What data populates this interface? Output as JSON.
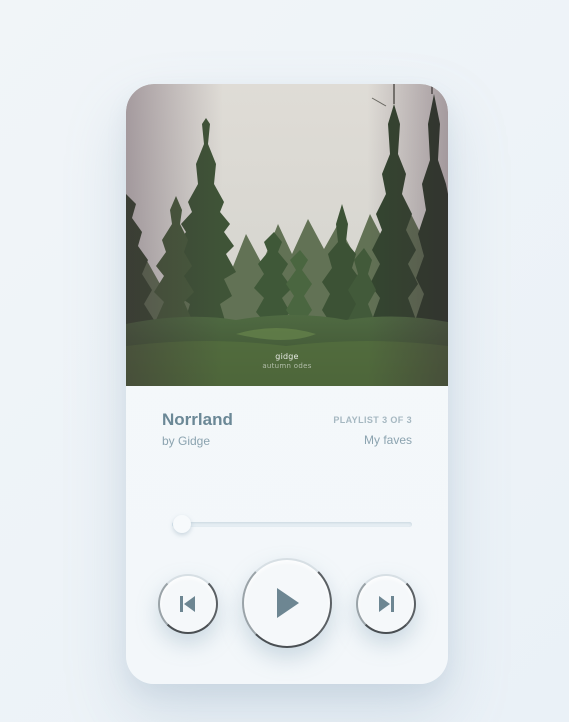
{
  "cover": {
    "artist_text": "gidge",
    "album_text": "autumn odes"
  },
  "track": {
    "title": "Norrland",
    "artist": "by Gidge"
  },
  "playlist": {
    "position_label": "PLAYLIST 3 OF 3",
    "name": "My faves"
  },
  "progress": {
    "fraction": 0.04
  },
  "controls": {
    "previous_icon": "skip-previous-icon",
    "play_icon": "play-icon",
    "next_icon": "skip-next-icon"
  },
  "colors": {
    "accent": "#6b8896",
    "icon": "#6d8692",
    "background": "#eef3f7"
  }
}
